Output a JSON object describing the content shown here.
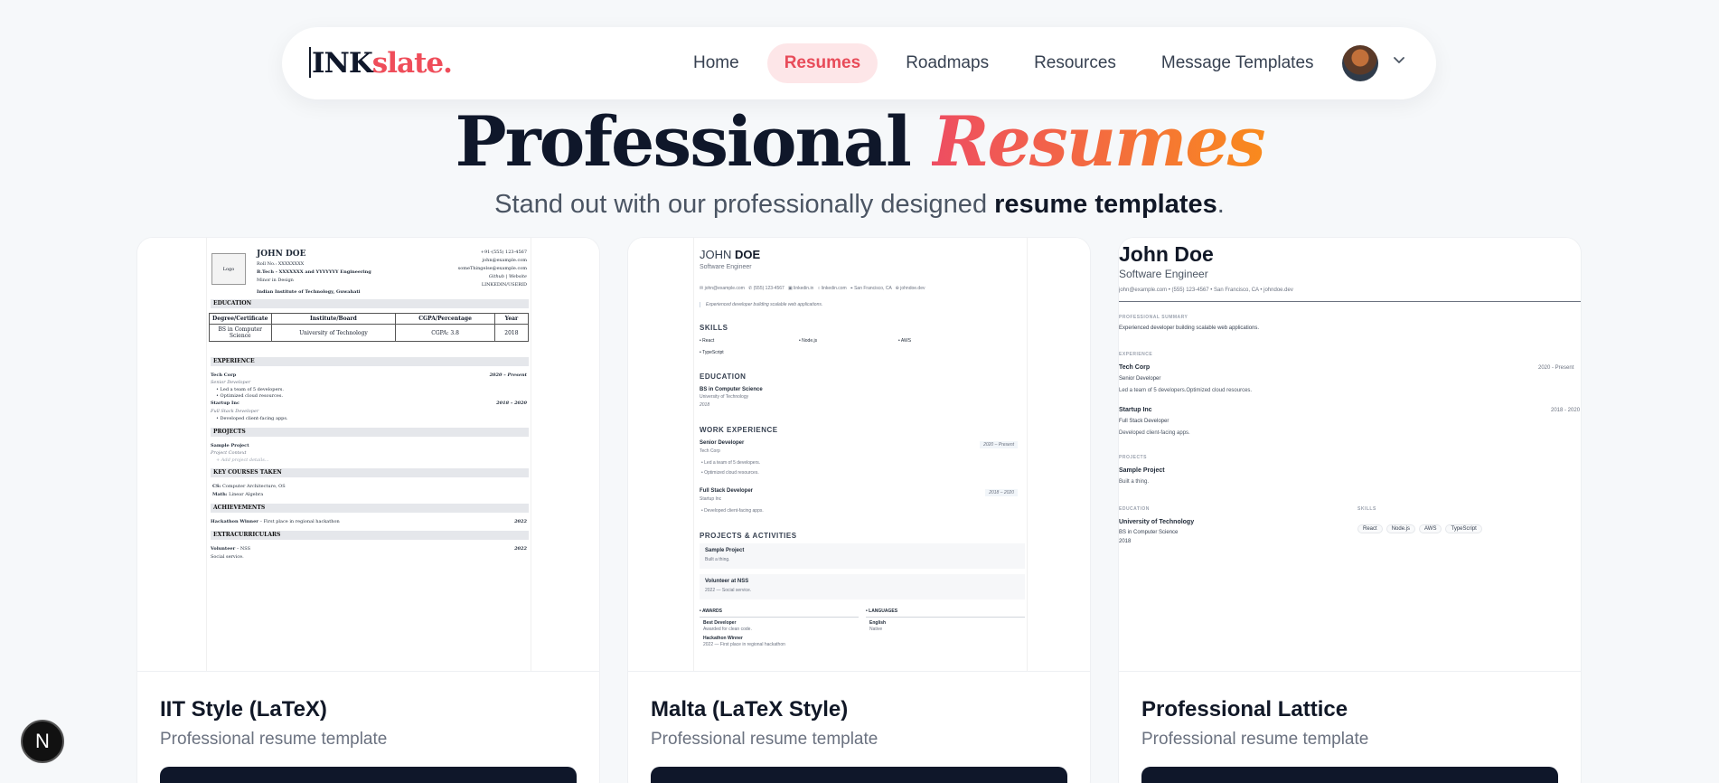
{
  "nav": {
    "logo_ink": "INK",
    "logo_slate": "slate.",
    "links": [
      "Home",
      "Resumes",
      "Roadmaps",
      "Resources",
      "Message Templates"
    ]
  },
  "hero": {
    "title_main": "Professional",
    "title_accent": "Resumes",
    "sub_pre": "Stand out with our professionally designed",
    "sub_bold": "resume templates",
    "sub_post": "."
  },
  "cards": [
    {
      "name": "IIT Style (LaTeX)",
      "desc": "Professional resume template"
    },
    {
      "name": "Malta (LaTeX Style)",
      "desc": "Professional resume template"
    },
    {
      "name": "Professional Lattice",
      "desc": "Professional resume template"
    }
  ],
  "iit": {
    "logo": "Logo",
    "name": "JOHN DOE",
    "roll": "Roll No.: XXXXXXXX",
    "degree": "B.Tech - XXXXXXX and YYYYYYY Engineering",
    "minor": "Minor in Design",
    "inst": "Indian Institute of Technology, Guwahati",
    "phone": "+91-(555) 123-4567",
    "email1": "john@example.com",
    "email2": "someThingelse@example.com",
    "links": "Github | Website",
    "linkedin": "LINKEDIN/USERID",
    "sec_edu": "EDUCATION",
    "tbl_head": [
      "Degree/Certificate",
      "Institute/Board",
      "CGPA/Percentage",
      "Year"
    ],
    "tbl_row": [
      "BS in Computer Science",
      "University of Technology",
      "CGPA: 3.8",
      "2018"
    ],
    "sec_exp": "EXPERIENCE",
    "exp1_co": "Tech Corp",
    "exp1_role": "Senior Developer",
    "exp1_date": "2020 – Present",
    "exp1_b1": "Led a team of 5 developers.",
    "exp1_b2": "Optimized cloud resources.",
    "exp2_co": "Startup Inc",
    "exp2_role": "Full Stack Developer",
    "exp2_date": "2018 – 2020",
    "exp2_b1": "Developed client-facing apps.",
    "sec_proj": "PROJECTS",
    "proj_name": "Sample Project",
    "proj_ctx": "Project Context",
    "proj_add": "+ Add project details...",
    "sec_courses": "KEY COURSES TAKEN",
    "course1_k": "CS:",
    "course1_v": "Computer Architecture, OS",
    "course2_k": "Math:",
    "course2_v": "Linear Algebra",
    "sec_ach": "ACHIEVEMENTS",
    "ach_k": "Hackathon Winner",
    "ach_v": " – First place in regional hackathon",
    "ach_y": "2022",
    "sec_extra": "EXTRACURRICULARS",
    "extra_k": "Volunteer",
    "extra_v": " – NSS",
    "extra_y": "2022",
    "extra_d": "Social service."
  },
  "malta": {
    "first": "JOHN",
    "last": "DOE",
    "title": "Software Engineer",
    "contacts": [
      "john@example.com",
      "(555) 123-4567",
      "linkedin.in",
      "linkedin.com",
      "San Francisco, CA",
      "johndoe.dev"
    ],
    "summary": "Experienced developer building scalable web applications.",
    "sec_skills": "SKILLS",
    "skills": [
      "React",
      "Node.js",
      "AWS",
      "TypeScript"
    ],
    "sec_edu": "EDUCATION",
    "edu_deg": "BS in Computer Science",
    "edu_inst": "University of Technology",
    "edu_year": "2018",
    "sec_work": "WORK EXPERIENCE",
    "w1_role": "Senior Developer",
    "w1_co": "Tech Corp",
    "w1_date": "2020 – Present",
    "w1_b1": "Led a team of 5 developers.",
    "w1_b2": "Optimized cloud resources.",
    "w2_role": "Full Stack Developer",
    "w2_co": "Startup Inc",
    "w2_date": "2018 – 2020",
    "w2_b1": "Developed client-facing apps.",
    "sec_proj": "PROJECTS & ACTIVITIES",
    "p1_name": "Sample Project",
    "p1_desc": "Built a thing.",
    "p2_name": "Volunteer at NSS",
    "p2_desc": "2022 — Social service.",
    "sec_awards": "AWARDS",
    "a1_name": "Best Developer",
    "a1_desc": "Awarded for clean code.",
    "a2_name": "Hackathon Winner",
    "a2_desc": "2022 — First place in regional hackathon",
    "sec_lang": "LANGUAGES",
    "lang_name": "English",
    "lang_level": "Native"
  },
  "lattice": {
    "name": "John Doe",
    "title": "Software Engineer",
    "contacts": "john@example.com   •  (555) 123-4567   •  San Francisco, CA   •  johndoe.dev",
    "sec_summary": "PROFESSIONAL SUMMARY",
    "summary": "Experienced developer building scalable web applications.",
    "sec_exp": "EXPERIENCE",
    "e1_co": "Tech Corp",
    "e1_date": "2020 - Present",
    "e1_role": "Senior Developer",
    "e1_desc": "Led a team of 5 developers.Optimized cloud resources.",
    "e2_co": "Startup Inc",
    "e2_date": "2018 - 2020",
    "e2_role": "Full Stack Developer",
    "e2_desc": "Developed client-facing apps.",
    "sec_proj": "PROJECTS",
    "proj_name": "Sample Project",
    "proj_desc": "Built a thing.",
    "sec_edu": "EDUCATION",
    "edu_inst": "University of Technology",
    "edu_deg": "BS in Computer Science",
    "edu_year": "2018",
    "sec_skills": "SKILLS",
    "skills": [
      "React",
      "Node.js",
      "AWS",
      "TypeScript"
    ]
  },
  "badge": "N"
}
